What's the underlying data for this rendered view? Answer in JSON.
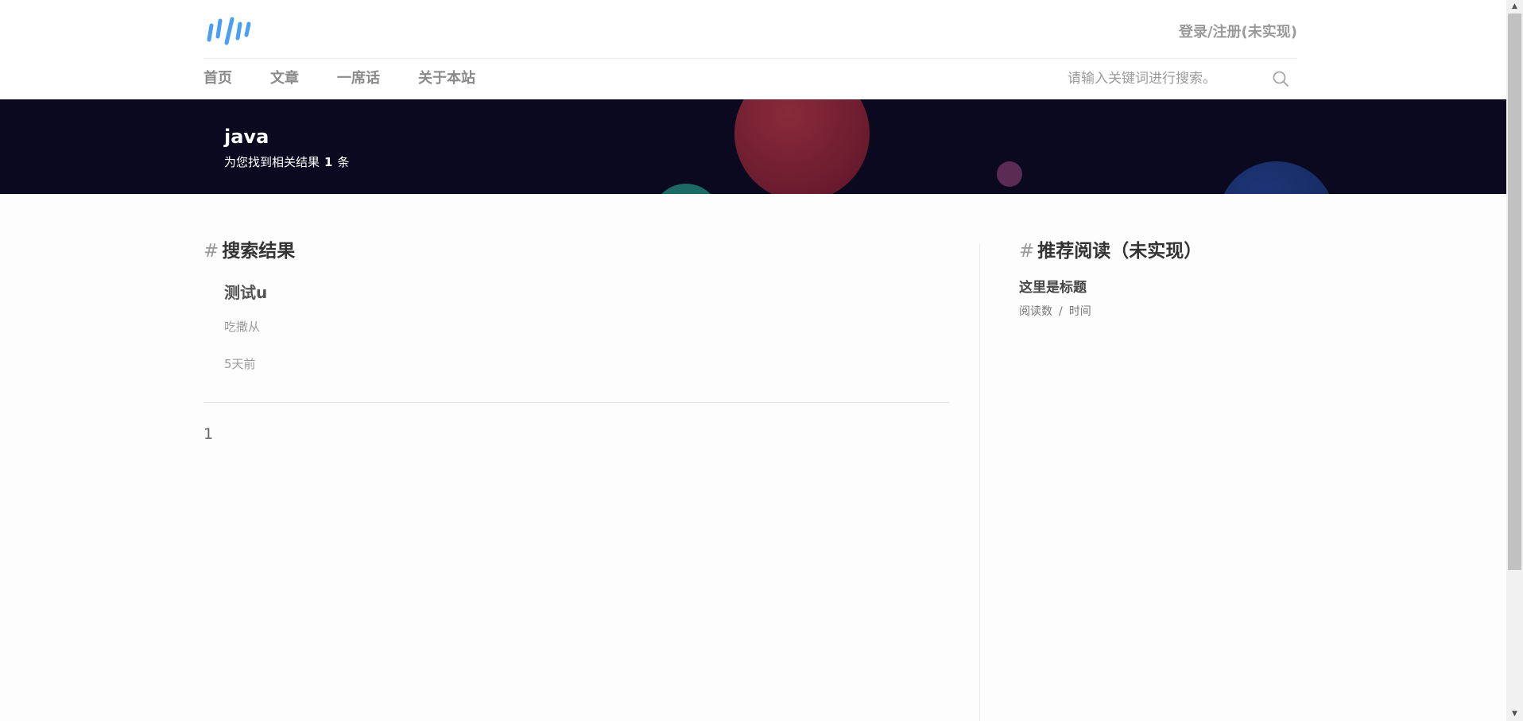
{
  "header": {
    "login_label": "登录/注册(未实现)",
    "nav": [
      "首页",
      "文章",
      "一席话",
      "关于本站"
    ],
    "search_placeholder": "请输入关键词进行搜索。",
    "logo_color": "#4a9ff5"
  },
  "banner": {
    "keyword": "java",
    "result_prefix": "为您找到相关结果",
    "result_count": "1",
    "result_suffix": "条",
    "background_color": "#0b0920"
  },
  "results": {
    "hash": "#",
    "title": "搜索结果",
    "items": [
      {
        "title": "测试u",
        "summary": "吃撒从",
        "time": "5天前"
      }
    ],
    "pagination": [
      "1"
    ]
  },
  "recommend": {
    "hash": "#",
    "title": "推荐阅读（未实现）",
    "items": [
      {
        "title": "这里是标题",
        "reads": "阅读数",
        "separator": "/",
        "time": "时间"
      }
    ]
  },
  "icons": {
    "search": "search-icon",
    "logo": "logo-icon",
    "scroll_up": "scroll-up-arrow-icon",
    "scroll_down": "scroll-down-arrow-icon"
  }
}
